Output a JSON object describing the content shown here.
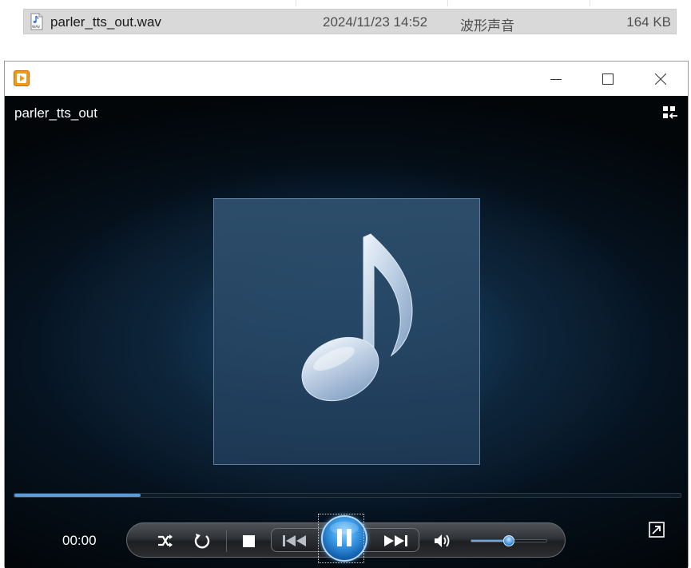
{
  "explorer": {
    "file": {
      "name": "parler_tts_out.wav",
      "icon": "wav-file-icon",
      "date_modified": "2024/11/23 14:52",
      "type": "波形声音",
      "size": "164 KB"
    }
  },
  "player": {
    "app_icon": "media-player-icon",
    "window_controls": {
      "minimize": "minimize-icon",
      "maximize": "maximize-icon",
      "close": "close-icon"
    },
    "now_playing": {
      "title": "parler_tts_out",
      "art": "music-note-icon"
    },
    "progress": 0.19,
    "time": "00:00",
    "volume": 0.5,
    "state": "playing",
    "colors": {
      "accent": "#3f9ee8",
      "seek_fill": "#5d9ad6",
      "app_icon": "#f29a17"
    },
    "controls": [
      "shuffle-icon",
      "repeat-icon",
      "stop-icon",
      "previous-icon",
      "pause-icon",
      "next-icon",
      "volume-icon"
    ]
  }
}
